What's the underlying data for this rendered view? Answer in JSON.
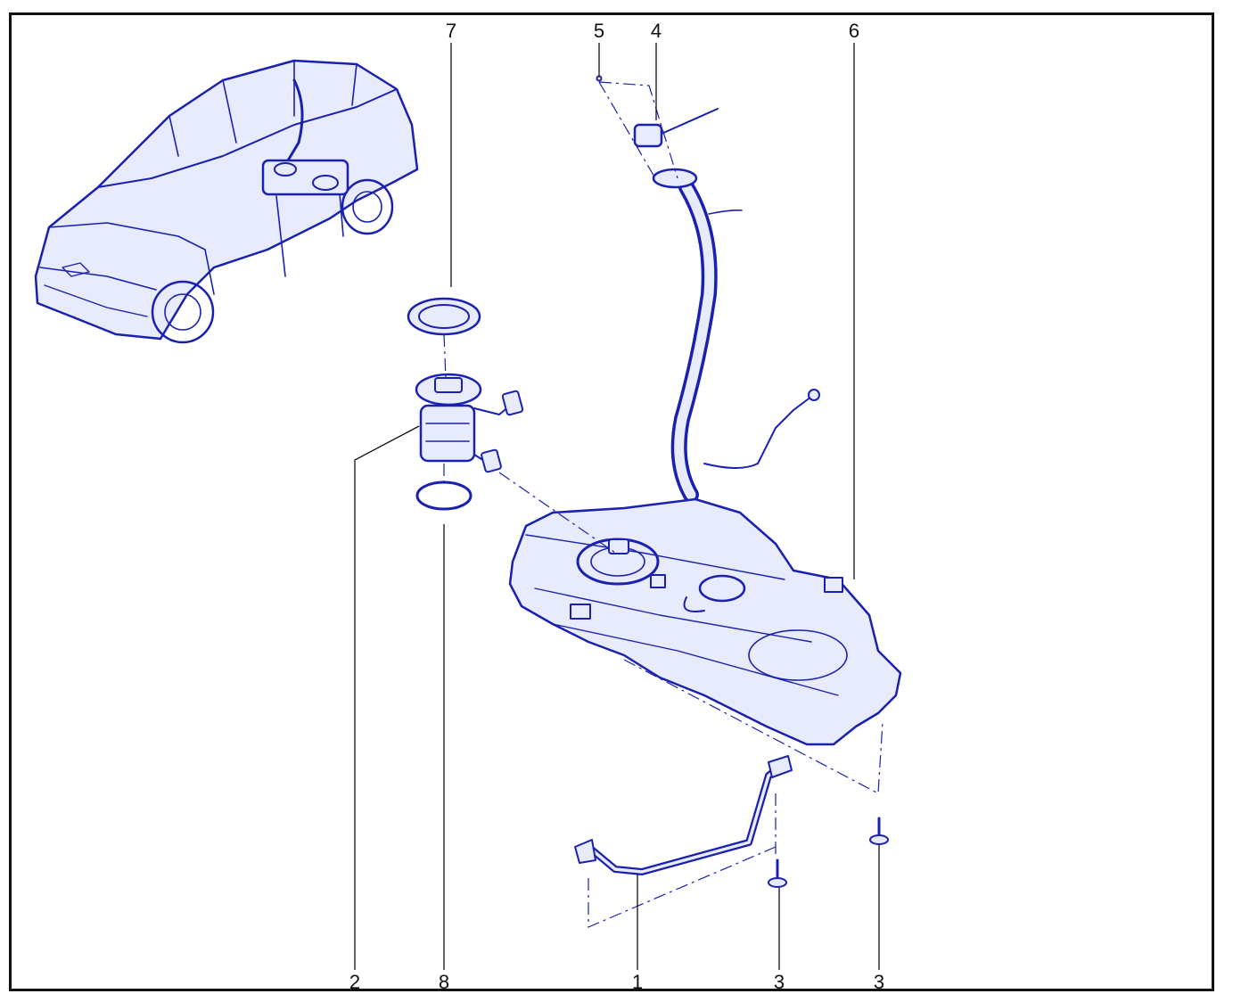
{
  "diagram": {
    "callouts": [
      {
        "id": "c7",
        "label": "7"
      },
      {
        "id": "c5",
        "label": "5"
      },
      {
        "id": "c4",
        "label": "4"
      },
      {
        "id": "c6",
        "label": "6"
      },
      {
        "id": "c2",
        "label": "2"
      },
      {
        "id": "c8",
        "label": "8"
      },
      {
        "id": "c1",
        "label": "1"
      },
      {
        "id": "c3a",
        "label": "3"
      },
      {
        "id": "c3b",
        "label": "3"
      }
    ],
    "colors": {
      "line_art": "#1a20b0",
      "frame": "#111111",
      "background": "#ffffff"
    }
  }
}
